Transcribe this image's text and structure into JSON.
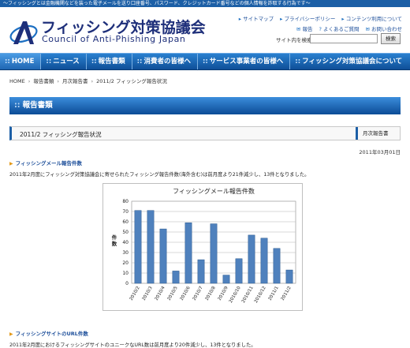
{
  "top_notice": "〜フィッシングとは金融機関などを装った電子メールを送り口座番号、パスワード、クレジットカード番号などの個人情報を詐取する行為です〜",
  "logo": {
    "jp": "フィッシング対策協議会",
    "en": "Council of Anti-Phishing Japan"
  },
  "util_links_row1": [
    "サイトマップ",
    "プライバシーポリシー",
    "コンテンツ利用について"
  ],
  "util_links_row2": [
    "報告",
    "よくあるご質問",
    "お問い合わせ"
  ],
  "search": {
    "label": "サイト内を検索",
    "placeholder": "",
    "button": "検索"
  },
  "nav": [
    "HOME",
    "ニュース",
    "報告書類",
    "消費者の皆様へ",
    "サービス事業者の皆様へ",
    "フィッシング対策協議会について"
  ],
  "breadcrumb": [
    "HOME",
    "報告書類",
    "月次報告書",
    "2011/2 フィッシング報告状況"
  ],
  "section_title": "報告書類",
  "page_title": "2011/2 フィッシング報告状況",
  "category": "月次報告書",
  "date": "2011年03月01日",
  "heading1": "フィッシングメール報告件数",
  "para1": "2011年2月度にフィッシング対策協議会に寄せられたフィッシング報告件数(海外含む)は前月度より21件減少し、13件となりました。",
  "heading2": "フィッシングサイトのURL件数",
  "para2": "2011年2月度におけるフィッシングサイトのユニークなURL数は前月度より20件減少し、13件となりました。",
  "colors": {
    "brand_blue": "#1c5fa6",
    "bar_blue": "#4f81bd",
    "arrow_orange": "#e39a1a"
  },
  "chart_data": {
    "type": "bar",
    "title": "フィッシングメール報告件数",
    "ylabel": "件数",
    "xlabel": "",
    "categories": [
      "2010/2",
      "2010/3",
      "2010/4",
      "2010/5",
      "2010/6",
      "2010/7",
      "2010/8",
      "2010/9",
      "2010/10",
      "2010/11",
      "2010/12",
      "2011/1",
      "2011/2"
    ],
    "values": [
      71,
      71,
      53,
      12,
      59,
      23,
      58,
      8,
      24,
      47,
      44,
      34,
      13
    ],
    "ylim": [
      0,
      80
    ],
    "yticks": [
      0,
      10,
      20,
      30,
      40,
      50,
      60,
      70,
      80
    ],
    "grid": true
  }
}
